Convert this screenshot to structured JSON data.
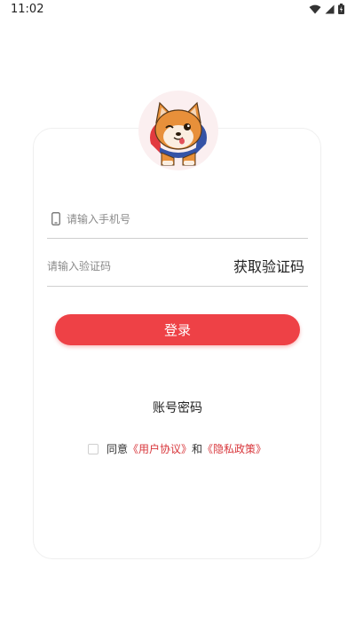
{
  "status_bar": {
    "time": "11:02"
  },
  "icons": {
    "wifi": "wifi-icon",
    "signal": "signal-icon",
    "battery": "battery-icon",
    "phone": "phone-icon",
    "avatar": "shiba-dog-avatar"
  },
  "login": {
    "phone_placeholder": "请输入手机号",
    "code_placeholder": "请输入验证码",
    "get_code_label": "获取验证码",
    "submit_label": "登录",
    "account_login_label": "账号密码"
  },
  "agreement": {
    "prefix": "同意",
    "user_agreement": "《用户协议》",
    "conjunction": "和",
    "privacy_policy": "《隐私政策》",
    "checked": false
  },
  "colors": {
    "accent": "#ee4146",
    "link": "#d8363b",
    "avatar_bg": "#fbeff0"
  }
}
